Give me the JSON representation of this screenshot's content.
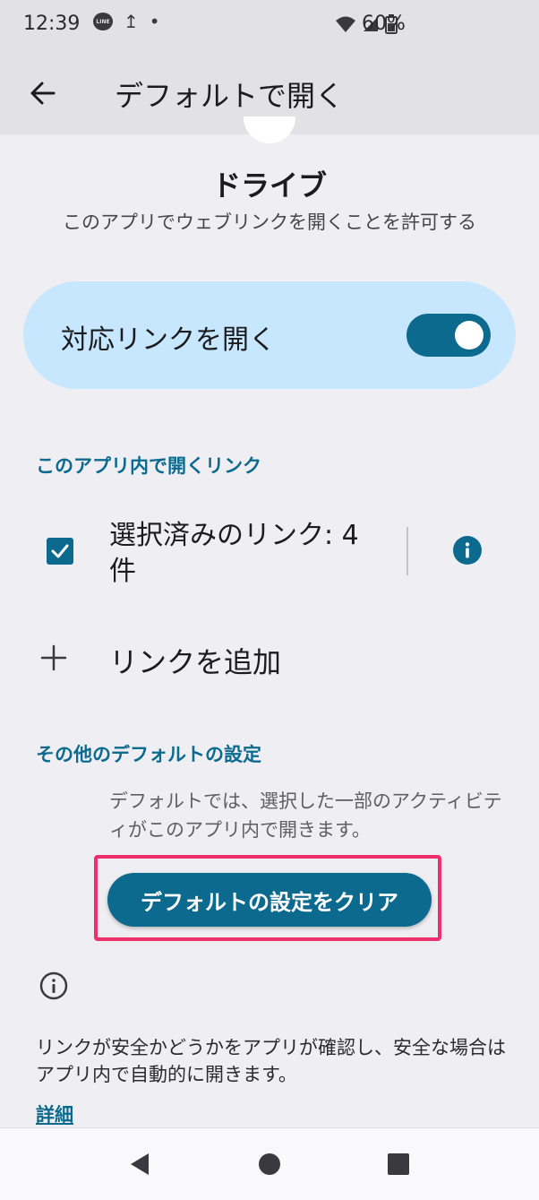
{
  "status_bar": {
    "time": "12:39",
    "notification_icons": [
      "line-icon",
      "upload-icon",
      "dot-icon"
    ],
    "line_label": "LINE",
    "upload_glyph": "↥",
    "dot_glyph": "•",
    "battery": "60%"
  },
  "app_bar": {
    "title": "デフォルトで開く"
  },
  "app_info": {
    "name": "ドライブ",
    "subtitle": "このアプリでウェブリンクを開くことを許可する"
  },
  "open_links": {
    "label": "対応リンクを開く",
    "enabled": true
  },
  "links_section": {
    "header": "このアプリ内で開くリンク",
    "selected_links": "選択済みのリンク: 4 件",
    "selected_checked": true,
    "add_link": "リンクを追加"
  },
  "defaults_section": {
    "header": "その他のデフォルトの設定",
    "description": "デフォルトでは、選択した一部のアクティビティがこのアプリ内で開きます。",
    "clear_button": "デフォルトの設定をクリア"
  },
  "footer_info": {
    "text": "リンクが安全かどうかをアプリが確認し、安全な場合はアプリ内で自動的に開きます。",
    "details_link": "詳細"
  },
  "colors": {
    "accent": "#0d6a8f",
    "card": "#c6e7fd",
    "highlight": "#ef2f6c",
    "background": "#efeff3"
  }
}
